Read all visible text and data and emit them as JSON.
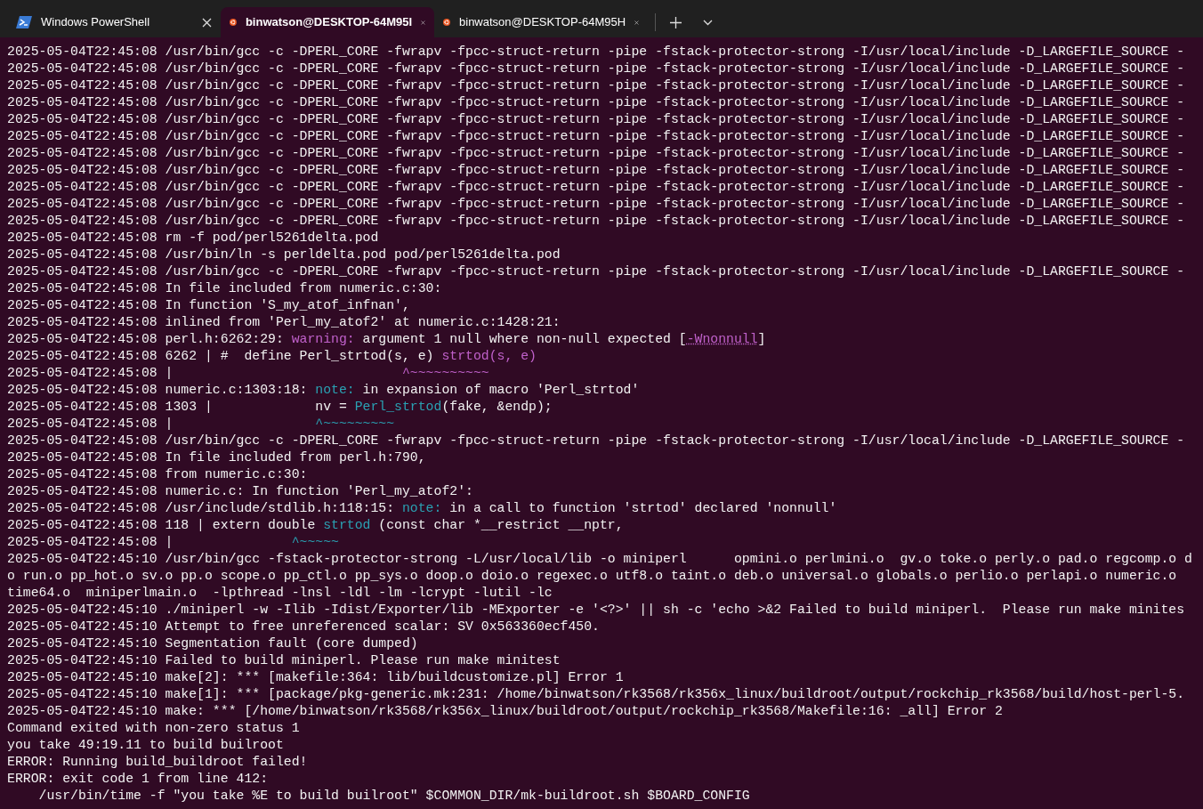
{
  "tabs": [
    {
      "title": "Windows PowerShell",
      "kind": "powershell",
      "selected": false
    },
    {
      "title": "binwatson@DESKTOP-64M95I",
      "kind": "linux",
      "selected": true
    },
    {
      "title": "binwatson@DESKTOP-64M95H",
      "kind": "linux",
      "selected": false
    }
  ],
  "terminal": {
    "lines": [
      "2025-05-04T22:45:08 /usr/bin/gcc -c -DPERL_CORE -fwrapv -fpcc-struct-return -pipe -fstack-protector-strong -I/usr/local/include -D_LARGEFILE_SOURCE -",
      "2025-05-04T22:45:08 /usr/bin/gcc -c -DPERL_CORE -fwrapv -fpcc-struct-return -pipe -fstack-protector-strong -I/usr/local/include -D_LARGEFILE_SOURCE -",
      "2025-05-04T22:45:08 /usr/bin/gcc -c -DPERL_CORE -fwrapv -fpcc-struct-return -pipe -fstack-protector-strong -I/usr/local/include -D_LARGEFILE_SOURCE -",
      "2025-05-04T22:45:08 /usr/bin/gcc -c -DPERL_CORE -fwrapv -fpcc-struct-return -pipe -fstack-protector-strong -I/usr/local/include -D_LARGEFILE_SOURCE -",
      "2025-05-04T22:45:08 /usr/bin/gcc -c -DPERL_CORE -fwrapv -fpcc-struct-return -pipe -fstack-protector-strong -I/usr/local/include -D_LARGEFILE_SOURCE -",
      "2025-05-04T22:45:08 /usr/bin/gcc -c -DPERL_CORE -fwrapv -fpcc-struct-return -pipe -fstack-protector-strong -I/usr/local/include -D_LARGEFILE_SOURCE -",
      "2025-05-04T22:45:08 /usr/bin/gcc -c -DPERL_CORE -fwrapv -fpcc-struct-return -pipe -fstack-protector-strong -I/usr/local/include -D_LARGEFILE_SOURCE -",
      "2025-05-04T22:45:08 /usr/bin/gcc -c -DPERL_CORE -fwrapv -fpcc-struct-return -pipe -fstack-protector-strong -I/usr/local/include -D_LARGEFILE_SOURCE -",
      "2025-05-04T22:45:08 /usr/bin/gcc -c -DPERL_CORE -fwrapv -fpcc-struct-return -pipe -fstack-protector-strong -I/usr/local/include -D_LARGEFILE_SOURCE -",
      "2025-05-04T22:45:08 /usr/bin/gcc -c -DPERL_CORE -fwrapv -fpcc-struct-return -pipe -fstack-protector-strong -I/usr/local/include -D_LARGEFILE_SOURCE -",
      "2025-05-04T22:45:08 /usr/bin/gcc -c -DPERL_CORE -fwrapv -fpcc-struct-return -pipe -fstack-protector-strong -I/usr/local/include -D_LARGEFILE_SOURCE -",
      "2025-05-04T22:45:08 rm -f pod/perl5261delta.pod",
      "2025-05-04T22:45:08 /usr/bin/ln -s perldelta.pod pod/perl5261delta.pod",
      "2025-05-04T22:45:08 /usr/bin/gcc -c -DPERL_CORE -fwrapv -fpcc-struct-return -pipe -fstack-protector-strong -I/usr/local/include -D_LARGEFILE_SOURCE -",
      "2025-05-04T22:45:08 In file included from numeric.c:30:",
      "2025-05-04T22:45:08 In function 'S_my_atof_infnan',",
      "2025-05-04T22:45:08 inlined from 'Perl_my_atof2' at numeric.c:1428:21:",
      [
        {
          "text": "2025-05-04T22:45:08 perl.h:6262:29: ",
          "kind": "plain"
        },
        {
          "text": "warning:",
          "kind": "warning"
        },
        {
          "text": " argument 1 null where non-null expected [",
          "kind": "plain"
        },
        {
          "text": "-Wnonnull",
          "kind": "option"
        },
        {
          "text": "]",
          "kind": "plain"
        }
      ],
      [
        {
          "text": "2025-05-04T22:45:08 6262 | #  define Perl_strtod(s, e) ",
          "kind": "plain"
        },
        {
          "text": "strtod(s, e)",
          "kind": "warning"
        }
      ],
      [
        {
          "text": "2025-05-04T22:45:08 |                             ",
          "kind": "plain"
        },
        {
          "text": "^~~~~~~~~~~",
          "kind": "warning"
        }
      ],
      [
        {
          "text": "2025-05-04T22:45:08 numeric.c:1303:18: ",
          "kind": "plain"
        },
        {
          "text": "note:",
          "kind": "note"
        },
        {
          "text": " in expansion of macro 'Perl_strtod'",
          "kind": "plain"
        }
      ],
      [
        {
          "text": "2025-05-04T22:45:08 1303 |             nv = ",
          "kind": "plain"
        },
        {
          "text": "Perl_strtod",
          "kind": "note"
        },
        {
          "text": "(fake, &endp);",
          "kind": "plain"
        }
      ],
      [
        {
          "text": "2025-05-04T22:45:08 |                  ",
          "kind": "plain"
        },
        {
          "text": "^~~~~~~~~~",
          "kind": "note"
        }
      ],
      "2025-05-04T22:45:08 /usr/bin/gcc -c -DPERL_CORE -fwrapv -fpcc-struct-return -pipe -fstack-protector-strong -I/usr/local/include -D_LARGEFILE_SOURCE -",
      "2025-05-04T22:45:08 In file included from perl.h:790,",
      "2025-05-04T22:45:08 from numeric.c:30:",
      "2025-05-04T22:45:08 numeric.c: In function 'Perl_my_atof2':",
      [
        {
          "text": "2025-05-04T22:45:08 /usr/include/stdlib.h:118:15: ",
          "kind": "plain"
        },
        {
          "text": "note:",
          "kind": "note"
        },
        {
          "text": " in a call to function 'strtod' declared 'nonnull'",
          "kind": "plain"
        }
      ],
      [
        {
          "text": "2025-05-04T22:45:08 118 | extern double ",
          "kind": "plain"
        },
        {
          "text": "strtod",
          "kind": "note"
        },
        {
          "text": " (const char *__restrict __nptr,",
          "kind": "plain"
        }
      ],
      [
        {
          "text": "2025-05-04T22:45:08 |               ",
          "kind": "plain"
        },
        {
          "text": "^~~~~~",
          "kind": "note"
        }
      ],
      "2025-05-04T22:45:10 /usr/bin/gcc -fstack-protector-strong -L/usr/local/lib -o miniperl      opmini.o perlmini.o  gv.o toke.o perly.o pad.o regcomp.o d",
      "o run.o pp_hot.o sv.o pp.o scope.o pp_ctl.o pp_sys.o doop.o doio.o regexec.o utf8.o taint.o deb.o universal.o globals.o perlio.o perlapi.o numeric.o",
      "time64.o  miniperlmain.o  -lpthread -lnsl -ldl -lm -lcrypt -lutil -lc",
      "2025-05-04T22:45:10 ./miniperl -w -Ilib -Idist/Exporter/lib -MExporter -e '<?>' || sh -c 'echo >&2 Failed to build miniperl.  Please run make minites",
      "2025-05-04T22:45:10 Attempt to free unreferenced scalar: SV 0x563360ecf450.",
      "2025-05-04T22:45:10 Segmentation fault (core dumped)",
      "2025-05-04T22:45:10 Failed to build miniperl. Please run make minitest",
      "2025-05-04T22:45:10 make[2]: *** [makefile:364: lib/buildcustomize.pl] Error 1",
      "2025-05-04T22:45:10 make[1]: *** [package/pkg-generic.mk:231: /home/binwatson/rk3568/rk356x_linux/buildroot/output/rockchip_rk3568/build/host-perl-5.",
      "2025-05-04T22:45:10 make: *** [/home/binwatson/rk3568/rk356x_linux/buildroot/output/rockchip_rk3568/Makefile:16: _all] Error 2",
      "Command exited with non-zero status 1",
      "you take 49:19.11 to build builroot",
      "ERROR: Running build_buildroot failed!",
      "ERROR: exit code 1 from line 412:",
      "    /usr/bin/time -f \"you take %E to build builroot\" $COMMON_DIR/mk-buildroot.sh $BOARD_CONFIG"
    ]
  }
}
